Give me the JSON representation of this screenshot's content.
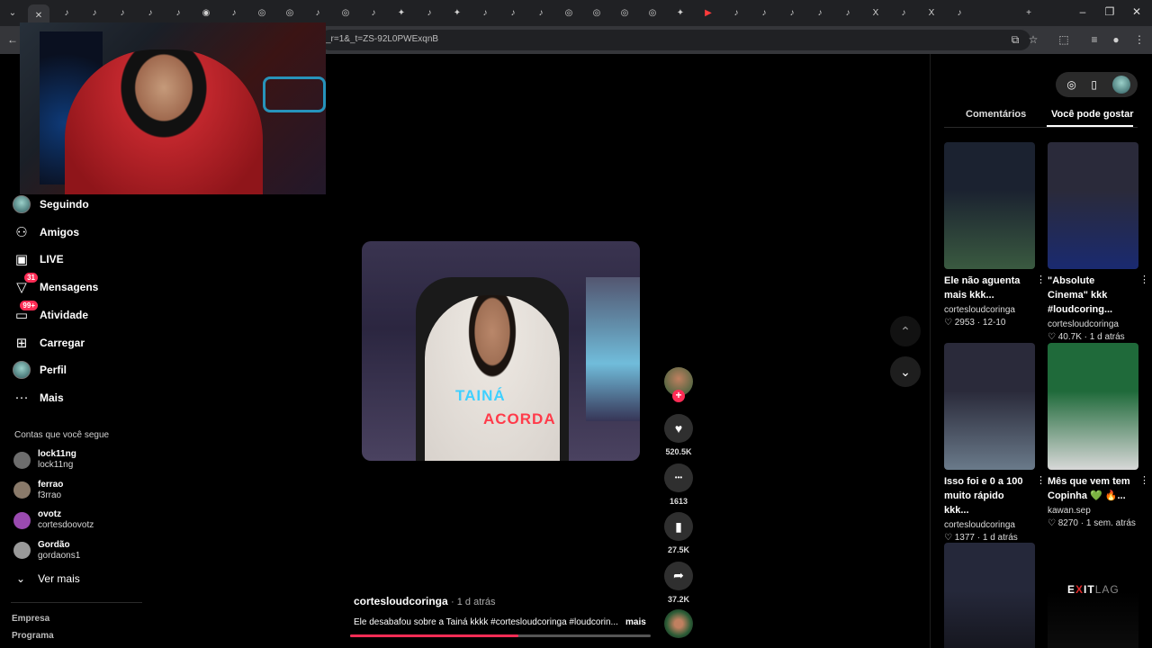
{
  "browser": {
    "url": "_r=1&_t=ZS-92L0PWExqnB",
    "tab_count": 36,
    "window_controls": [
      "–",
      "❐",
      "✕"
    ]
  },
  "sidebar": {
    "items": [
      {
        "label": "Seguindo",
        "icon": "following-avatar-icon",
        "badge": ""
      },
      {
        "label": "Amigos",
        "icon": "friends-icon",
        "badge": ""
      },
      {
        "label": "LIVE",
        "icon": "live-icon",
        "badge": ""
      },
      {
        "label": "Mensagens",
        "icon": "messages-icon",
        "badge": "31"
      },
      {
        "label": "Atividade",
        "icon": "activity-icon",
        "badge": "99+"
      },
      {
        "label": "Carregar",
        "icon": "upload-icon",
        "badge": ""
      },
      {
        "label": "Perfil",
        "icon": "profile-avatar-icon",
        "badge": ""
      },
      {
        "label": "Mais",
        "icon": "more-dots-icon",
        "badge": ""
      }
    ],
    "following_title": "Contas que você segue",
    "accounts": [
      {
        "name": "lock11ng",
        "handle": "lock11ng",
        "color": "#6d6d6d"
      },
      {
        "name": "ferrao",
        "handle": "f3rrao",
        "color": "#8a7a6a"
      },
      {
        "name": "ovotz",
        "handle": "cortesdoovotz",
        "color": "#9a4ab0"
      },
      {
        "name": "Gordão",
        "handle": "gordaons1",
        "color": "#9a9a9a"
      }
    ],
    "see_more": "Ver mais",
    "footer": [
      "Empresa",
      "Programa"
    ]
  },
  "video": {
    "caption_line1": "TAINÁ",
    "caption_line2": "ACORDA",
    "author": "cortesloudcoringa",
    "time_ago": "· 1 d atrás",
    "description": "Ele desabafou sobre a Tainá kkkk #cortesloudcoringa #loudcorin...",
    "more": "mais",
    "progress": 0.56
  },
  "actions": [
    {
      "name": "like",
      "icon": "heart-icon",
      "glyph": "♥",
      "count": "520.5K"
    },
    {
      "name": "comment",
      "icon": "comment-icon",
      "glyph": "•••",
      "count": "1613"
    },
    {
      "name": "save",
      "icon": "bookmark-icon",
      "glyph": "▮",
      "count": "27.5K"
    },
    {
      "name": "share",
      "icon": "share-icon",
      "glyph": "➦",
      "count": "37.2K"
    }
  ],
  "right_panel": {
    "tabs": [
      "Comentários",
      "Você pode gostar"
    ],
    "active_tab": "Você pode gostar",
    "cards": [
      {
        "title": "Ele não aguenta mais kkk...",
        "user": "cortesloudcoringa",
        "stats": "♡ 2953 · 12-10",
        "colors": [
          "#1b2230",
          "#3a5a40"
        ]
      },
      {
        "title": "\"Absolute Cinema\" kkk #loudcoring...",
        "user": "cortesloudcoringa",
        "stats": "♡ 40.7K · 1 d atrás",
        "colors": [
          "#2a2a3a",
          "#1a2a70"
        ]
      },
      {
        "title": "Isso foi e 0 a 100 muito rápido kkk...",
        "user": "cortesloudcoringa",
        "stats": "♡ 1377 · 1 d atrás",
        "colors": [
          "#2a2a3a",
          "#6a7a8a"
        ]
      },
      {
        "title": "Mês que vem tem Copinha 💚 🔥...",
        "user": "kawan.sep",
        "stats": "♡ 8270 · 1 sem. atrás",
        "colors": [
          "#1f6a3a",
          "#d8d8d8"
        ]
      },
      {
        "title": "",
        "user": "",
        "stats": "",
        "colors": [
          "#25283a",
          "#101015"
        ]
      },
      {
        "title": "",
        "user": "",
        "stats": "",
        "colors": [
          "#000000",
          "#111111"
        ],
        "logo": "EXITLAG"
      }
    ]
  },
  "colors": {
    "accent": "#fe2c55",
    "background": "#000000"
  }
}
